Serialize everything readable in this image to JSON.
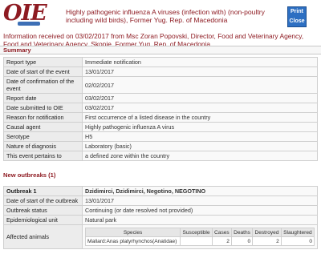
{
  "header": {
    "logo_text": "OIE",
    "title": "Highly pathogenic influenza A viruses (infection with) (non-poultry including wild birds), Former Yug. Rep. of Macedonia",
    "print_label": "Print",
    "close_label": "Close"
  },
  "info_text": "Information received on 03/02/2017 from Msc Zoran Popovski, Director, Food and Veterinary Agency, Food and Veterinary Agency, Skopje, Former Yug. Rep. of Macedonia",
  "summary": {
    "heading": "Summary",
    "rows": [
      {
        "label": "Report type",
        "value": "Immediate notification"
      },
      {
        "label": "Date of start of the event",
        "value": "13/01/2017"
      },
      {
        "label": "Date of confirmation of the event",
        "value": "02/02/2017"
      },
      {
        "label": "Report date",
        "value": "03/02/2017"
      },
      {
        "label": "Date submitted to OIE",
        "value": "03/02/2017"
      },
      {
        "label": "Reason for notification",
        "value": "First occurrence of a listed disease in the country"
      },
      {
        "label": "Causal agent",
        "value": "Highly pathogenic influenza A virus"
      },
      {
        "label": "Serotype",
        "value": "H5"
      },
      {
        "label": "Nature of diagnosis",
        "value": "Laboratory (basic)"
      },
      {
        "label": "This event pertains to",
        "value": "a defined zone within the country"
      }
    ]
  },
  "outbreaks": {
    "heading": "New outbreaks (1)",
    "rows": [
      {
        "label": "Outbreak 1",
        "value": "Dzidimirci, Dzidimirci, Negotino, NEGOTINO"
      },
      {
        "label": "Date of start of the outbreak",
        "value": "13/01/2017"
      },
      {
        "label": "Outbreak status",
        "value": "Continuing (or date resolved not provided)"
      },
      {
        "label": "Epidemiological unit",
        "value": "Natural park"
      }
    ],
    "affected_label": "Affected animals",
    "animals": {
      "headers": [
        "Species",
        "Susceptible",
        "Cases",
        "Deaths",
        "Destroyed",
        "Slaughtered"
      ],
      "rows": [
        [
          "Mallard:Anas platyrhynchos(Anatidae)",
          "",
          "2",
          "0",
          "2",
          "0"
        ]
      ]
    }
  }
}
